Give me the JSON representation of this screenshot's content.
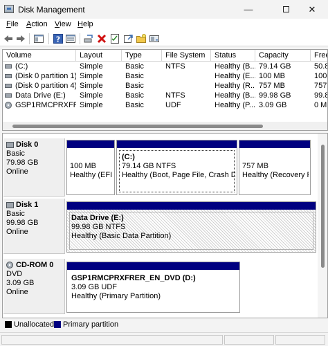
{
  "window": {
    "title": "Disk Management",
    "minimize": "—",
    "close": "✕"
  },
  "menu": [
    {
      "label_u": "F",
      "label_rest": "ile"
    },
    {
      "label_u": "A",
      "label_rest": "ction"
    },
    {
      "label_u": "V",
      "label_rest": "iew"
    },
    {
      "label_u": "H",
      "label_rest": "elp"
    }
  ],
  "toolbar_icons": [
    "back-arrow-icon",
    "forward-arrow-icon",
    "show-hide-console-tree-icon",
    "help-icon",
    "properties-icon",
    "connect-icon",
    "delete-icon",
    "checklist-icon",
    "export-icon",
    "new-folder-icon",
    "drive-icon"
  ],
  "colors": {
    "primary_partition": "#000080",
    "unallocated": "#000000",
    "delete_red": "#d01010"
  },
  "volume_table": {
    "columns": [
      "Volume",
      "Layout",
      "Type",
      "File System",
      "Status",
      "Capacity",
      "Free"
    ],
    "rows": [
      {
        "volume": "(C:)",
        "layout": "Simple",
        "type": "Basic",
        "fs": "NTFS",
        "status": "Healthy (B...",
        "capacity": "79.14 GB",
        "free": "50.8",
        "icon": "disk-icon"
      },
      {
        "volume": "(Disk 0 partition 1)",
        "layout": "Simple",
        "type": "Basic",
        "fs": "",
        "status": "Healthy (E...",
        "capacity": "100 MB",
        "free": "100",
        "icon": "disk-icon"
      },
      {
        "volume": "(Disk 0 partition 4)",
        "layout": "Simple",
        "type": "Basic",
        "fs": "",
        "status": "Healthy (R...",
        "capacity": "757 MB",
        "free": "757",
        "icon": "disk-icon"
      },
      {
        "volume": "Data Drive (E:)",
        "layout": "Simple",
        "type": "Basic",
        "fs": "NTFS",
        "status": "Healthy (B...",
        "capacity": "99.98 GB",
        "free": "99.8",
        "icon": "disk-icon"
      },
      {
        "volume": "GSP1RMCPRXFRE...",
        "layout": "Simple",
        "type": "Basic",
        "fs": "UDF",
        "status": "Healthy (P...",
        "capacity": "3.09 GB",
        "free": "0 M",
        "icon": "cd-icon"
      }
    ]
  },
  "disks": [
    {
      "name": "Disk 0",
      "type": "Basic",
      "size": "79.98 GB",
      "state": "Online",
      "partitions": [
        {
          "name": "",
          "size": "100 MB",
          "status": "Healthy (EFI S"
        },
        {
          "name": "(C:)",
          "size": "79.14 GB NTFS",
          "status": "Healthy (Boot, Page File, Crash Dump"
        },
        {
          "name": "",
          "size": "757 MB",
          "status": "Healthy (Recovery Pa"
        }
      ]
    },
    {
      "name": "Disk 1",
      "type": "Basic",
      "size": "99.98 GB",
      "state": "Online",
      "partitions": [
        {
          "name": "Data Drive  (E:)",
          "size": "99.98 GB NTFS",
          "status": "Healthy (Basic Data Partition)"
        }
      ]
    },
    {
      "name": "CD-ROM 0",
      "type": "DVD",
      "size": "3.09 GB",
      "state": "Online",
      "partitions": [
        {
          "name": "GSP1RMCPRXFRER_EN_DVD  (D:)",
          "size": "3.09 GB UDF",
          "status": "Healthy (Primary Partition)"
        }
      ]
    }
  ],
  "legend": {
    "unallocated": "Unallocated",
    "primary": "Primary partition"
  }
}
